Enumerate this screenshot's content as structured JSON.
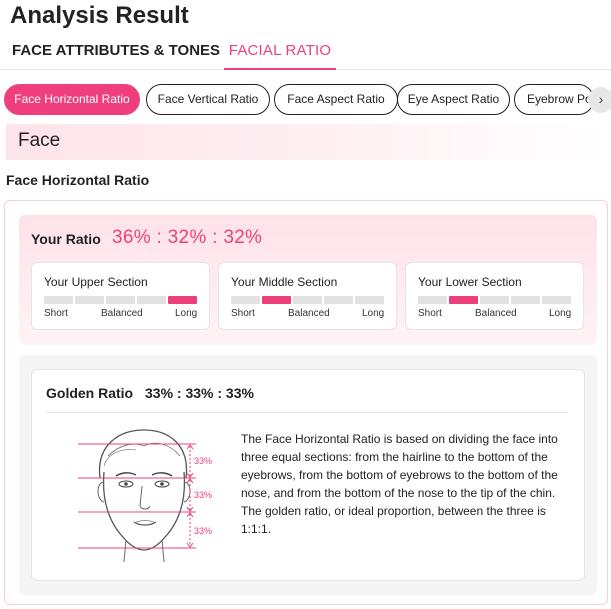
{
  "page": {
    "title": "Analysis Result"
  },
  "tabs": [
    {
      "label": "FACE ATTRIBUTES & TONES"
    },
    {
      "label": "FACIAL RATIO"
    }
  ],
  "chips": [
    {
      "label": "Face Horizontal Ratio"
    },
    {
      "label": "Face Vertical Ratio"
    },
    {
      "label": "Face Aspect Ratio"
    },
    {
      "label": "Eye Aspect Ratio"
    },
    {
      "label": "Eyebrow Po"
    }
  ],
  "chip_arrow": {
    "icon": "chevron-right-icon",
    "glyph": "›"
  },
  "section": {
    "heading": "Face",
    "subtitle": "Face Horizontal Ratio"
  },
  "ratio": {
    "label": "Your Ratio",
    "value": "36% : 32% : 32%",
    "cards": [
      {
        "title": "Your Upper Section",
        "level_index": 4,
        "scale": [
          "Short",
          "Balanced",
          "Long"
        ]
      },
      {
        "title": "Your Middle Section",
        "level_index": 1,
        "scale": [
          "Short",
          "Balanced",
          "Long"
        ]
      },
      {
        "title": "Your Lower Section",
        "level_index": 1,
        "scale": [
          "Short",
          "Balanced",
          "Long"
        ]
      }
    ]
  },
  "golden": {
    "label": "Golden Ratio",
    "value": "33% : 33% : 33%",
    "figure_labels": [
      "33%",
      "33%",
      "33%"
    ],
    "description": "The Face Horizontal Ratio is based on dividing the face into three equal sections: from the hairline to the bottom of the eyebrows, from the bottom of eyebrows to the bottom of the nose, and from the bottom of the nose to the tip of the chin. The golden ratio, or ideal proportion, between the three is 1:1:1."
  },
  "colors": {
    "accent": "#ee3f7c",
    "bar_off": "#e2e2e2",
    "panel_pink": "#fde2e9",
    "border_pink": "#f7cdd6"
  }
}
